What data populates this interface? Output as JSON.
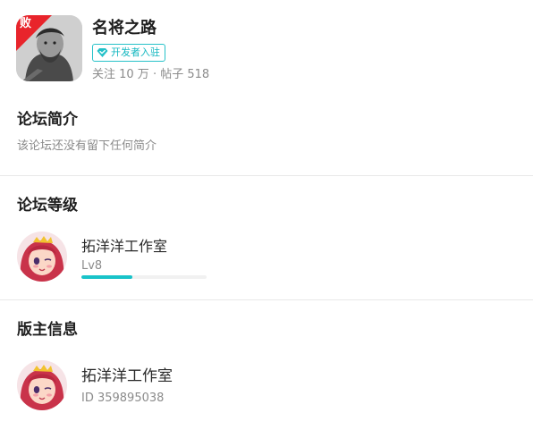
{
  "forum": {
    "name": "名将之路",
    "corner_badge": "败",
    "dev_badge": "开发者入驻",
    "stats": "关注 10 万 · 帖子 518"
  },
  "intro": {
    "title": "论坛简介",
    "text": "该论坛还没有留下任何简介"
  },
  "level": {
    "title": "论坛等级",
    "user_name": "拓洋洋工作室",
    "level_label": "Lv8",
    "progress": 0.41
  },
  "moderator": {
    "title": "版主信息",
    "user_name": "拓洋洋工作室",
    "id_label": "ID 359895038"
  },
  "colors": {
    "accent": "#18c3c9",
    "badge_red": "#e8242b",
    "muted_text": "#8b8b8b"
  }
}
